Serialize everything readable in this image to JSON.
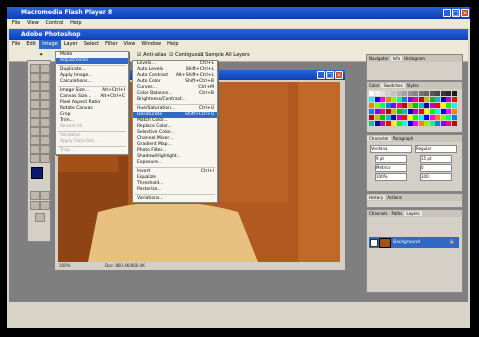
{
  "flash": {
    "title": "Macromedia Flash Player 8",
    "menu": [
      "File",
      "View",
      "Control",
      "Help"
    ]
  },
  "ps": {
    "title": "Adobe Photoshop",
    "menu": [
      "File",
      "Edit",
      "Image",
      "Layer",
      "Select",
      "Filter",
      "View",
      "Window",
      "Help"
    ],
    "options": {
      "antialias": "Anti-alias",
      "contiguous": "Contiguous",
      "sample_all": "Sample All Layers"
    }
  },
  "image_menu": [
    {
      "label": "Mode",
      "sc": "",
      "type": "item"
    },
    {
      "label": "Adjustments",
      "sc": "",
      "type": "hl"
    },
    {
      "type": "sep"
    },
    {
      "label": "Duplicate...",
      "sc": "",
      "type": "item"
    },
    {
      "label": "Apply Image...",
      "sc": "",
      "type": "item"
    },
    {
      "label": "Calculations...",
      "sc": "",
      "type": "item"
    },
    {
      "type": "sep"
    },
    {
      "label": "Image Size...",
      "sc": "Alt+Ctrl+I",
      "type": "item"
    },
    {
      "label": "Canvas Size...",
      "sc": "Alt+Ctrl+C",
      "type": "item"
    },
    {
      "label": "Pixel Aspect Ratio",
      "sc": "",
      "type": "item"
    },
    {
      "label": "Rotate Canvas",
      "sc": "",
      "type": "item"
    },
    {
      "label": "Crop",
      "sc": "",
      "type": "item"
    },
    {
      "label": "Trim...",
      "sc": "",
      "type": "item"
    },
    {
      "label": "Reveal All",
      "sc": "",
      "type": "dis"
    },
    {
      "type": "sep"
    },
    {
      "label": "Variables",
      "sc": "",
      "type": "dis"
    },
    {
      "label": "Apply Data Set...",
      "sc": "",
      "type": "dis"
    },
    {
      "type": "sep"
    },
    {
      "label": "Trap...",
      "sc": "",
      "type": "dis"
    }
  ],
  "adj_menu": [
    {
      "label": "Levels...",
      "sc": "Ctrl+L",
      "type": "item"
    },
    {
      "label": "Auto Levels",
      "sc": "Shift+Ctrl+L",
      "type": "item"
    },
    {
      "label": "Auto Contrast",
      "sc": "Alt+Shift+Ctrl+L",
      "type": "item"
    },
    {
      "label": "Auto Color",
      "sc": "Shift+Ctrl+B",
      "type": "item"
    },
    {
      "label": "Curves...",
      "sc": "Ctrl+M",
      "type": "item"
    },
    {
      "label": "Color Balance...",
      "sc": "Ctrl+B",
      "type": "item"
    },
    {
      "label": "Brightness/Contrast...",
      "sc": "",
      "type": "item"
    },
    {
      "type": "sep"
    },
    {
      "label": "Hue/Saturation...",
      "sc": "Ctrl+U",
      "type": "item"
    },
    {
      "label": "Desaturate",
      "sc": "Shift+Ctrl+U",
      "type": "hl"
    },
    {
      "label": "Match Color...",
      "sc": "",
      "type": "item"
    },
    {
      "label": "Replace Color...",
      "sc": "",
      "type": "item"
    },
    {
      "label": "Selective Color...",
      "sc": "",
      "type": "item"
    },
    {
      "label": "Channel Mixer...",
      "sc": "",
      "type": "item"
    },
    {
      "label": "Gradient Map...",
      "sc": "",
      "type": "item"
    },
    {
      "label": "Photo Filter...",
      "sc": "",
      "type": "item"
    },
    {
      "label": "Shadow/Highlight...",
      "sc": "",
      "type": "item"
    },
    {
      "label": "Exposure...",
      "sc": "",
      "type": "item"
    },
    {
      "type": "sep"
    },
    {
      "label": "Invert",
      "sc": "Ctrl+I",
      "type": "item"
    },
    {
      "label": "Equalize",
      "sc": "",
      "type": "item"
    },
    {
      "label": "Threshold...",
      "sc": "",
      "type": "item"
    },
    {
      "label": "Posterize...",
      "sc": "",
      "type": "item"
    },
    {
      "type": "sep"
    },
    {
      "label": "Variations...",
      "sc": "",
      "type": "item"
    }
  ],
  "doc": {
    "zoom": "100%",
    "info": "Doc: 860.4K/860.4K"
  },
  "palettes": {
    "nav_tabs": [
      "Navigator",
      "Info",
      "Histogram"
    ],
    "color_tabs": [
      "Color",
      "Swatches",
      "Styles"
    ],
    "char_tabs": [
      "Character",
      "Paragraph"
    ],
    "char": {
      "font": "Verdana",
      "style": "Regular",
      "size": "9 pt",
      "leading": "15 pt",
      "kern": "Metrics",
      "track": "0",
      "vscale": "100%",
      "hscale": "100"
    },
    "hist_tabs": [
      "History",
      "Actions"
    ],
    "layer_tabs": [
      "Channels",
      "Paths",
      "Layers"
    ],
    "layer_name": "Background"
  },
  "colors": {
    "fg": "#0a1a6e",
    "bg": "#ffffff"
  }
}
